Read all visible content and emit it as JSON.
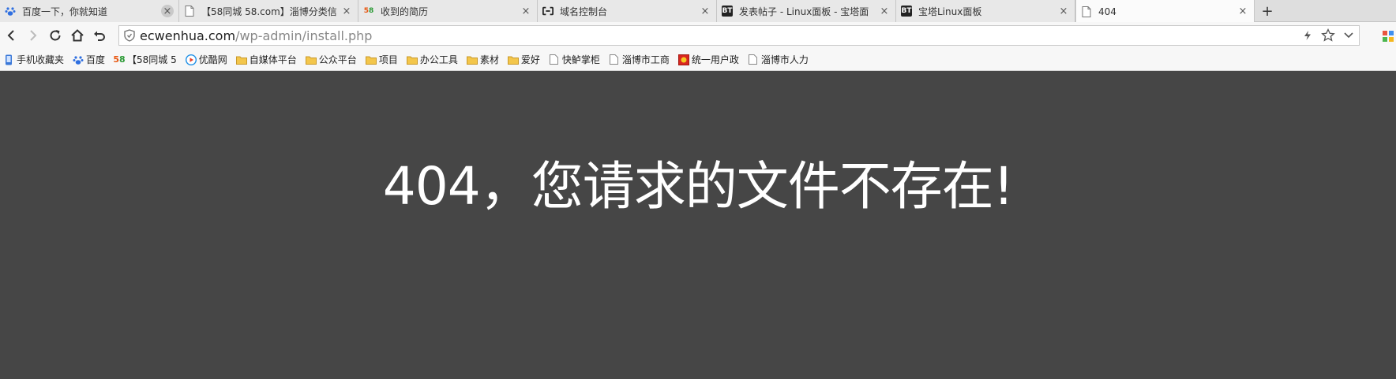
{
  "tabs": [
    {
      "title": "百度一下，你就知道",
      "icon": "baidu-paw-icon",
      "close": "×"
    },
    {
      "title": "【58同城 58.com】淄博分类信",
      "icon": "blank-page-icon",
      "close": "×"
    },
    {
      "title": "收到的简历",
      "icon": "58-logo-icon",
      "close": "×"
    },
    {
      "title": "域名控制台",
      "icon": "aliyun-cloud-icon",
      "close": "×"
    },
    {
      "title": "发表帖子 - Linux面板 - 宝塔面",
      "icon": "bt-logo-icon",
      "close": "×"
    },
    {
      "title": "宝塔Linux面板",
      "icon": "bt-logo-icon",
      "close": "×"
    },
    {
      "title": "404",
      "icon": "blank-page-icon",
      "close": "×",
      "active": true
    }
  ],
  "new_tab": "+",
  "address": {
    "host": "ecwenhua.com",
    "path": "/wp-admin/install.php"
  },
  "bookmarks": [
    {
      "label": "手机收藏夹",
      "icon": "phone-icon"
    },
    {
      "label": "百度",
      "icon": "baidu-paw-icon"
    },
    {
      "label": "【58同城 5",
      "icon": "58-logo-icon"
    },
    {
      "label": "优酷网",
      "icon": "youku-icon"
    },
    {
      "label": "自媒体平台",
      "icon": "folder-icon"
    },
    {
      "label": "公众平台",
      "icon": "folder-icon"
    },
    {
      "label": "项目",
      "icon": "folder-icon"
    },
    {
      "label": "办公工具",
      "icon": "folder-icon"
    },
    {
      "label": "素材",
      "icon": "folder-icon"
    },
    {
      "label": "爱好",
      "icon": "folder-icon"
    },
    {
      "label": "快鲈掌柜",
      "icon": "blank-page-icon"
    },
    {
      "label": "淄博市工商",
      "icon": "blank-page-icon"
    },
    {
      "label": "统一用户政",
      "icon": "gov-emblem-icon"
    },
    {
      "label": "淄博市人力",
      "icon": "blank-page-icon"
    }
  ],
  "page": {
    "message": "404，您请求的文件不存在!"
  },
  "colors": {
    "background": "#464646",
    "message": "#ffffff",
    "folder": "#f3c64b"
  }
}
